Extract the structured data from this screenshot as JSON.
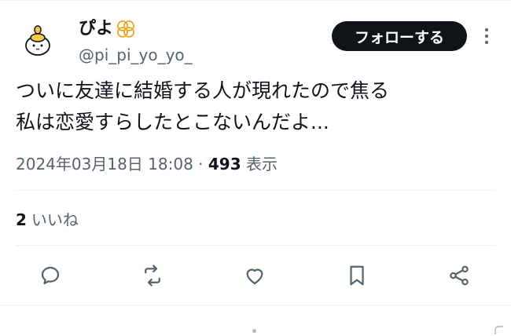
{
  "user": {
    "name": "ぴよ",
    "handle": "@pi_pi_yo_yo_"
  },
  "header": {
    "follow_label": "フォローする"
  },
  "tweet": {
    "text": "ついに友達に結婚する人が現れたので焦る\n私は恋愛すらしたとこないんだよ..."
  },
  "meta": {
    "timestamp": "2024年03月18日 18:08",
    "separator": " · ",
    "views_count": "493",
    "views_label": " 表示"
  },
  "stats": {
    "likes_count": "2",
    "likes_label": "いいね"
  },
  "icons": {
    "reply": "reply-icon",
    "retweet": "retweet-icon",
    "like": "heart-icon",
    "bookmark": "bookmark-icon",
    "share": "share-icon",
    "more": "more-dots-icon",
    "verified_badge": "orange-badge-icon"
  },
  "colors": {
    "text": "#0f1419",
    "secondary": "#536471",
    "divider": "#eff3f4",
    "badge": "#f5a623",
    "follow_bg": "#0f1419"
  }
}
